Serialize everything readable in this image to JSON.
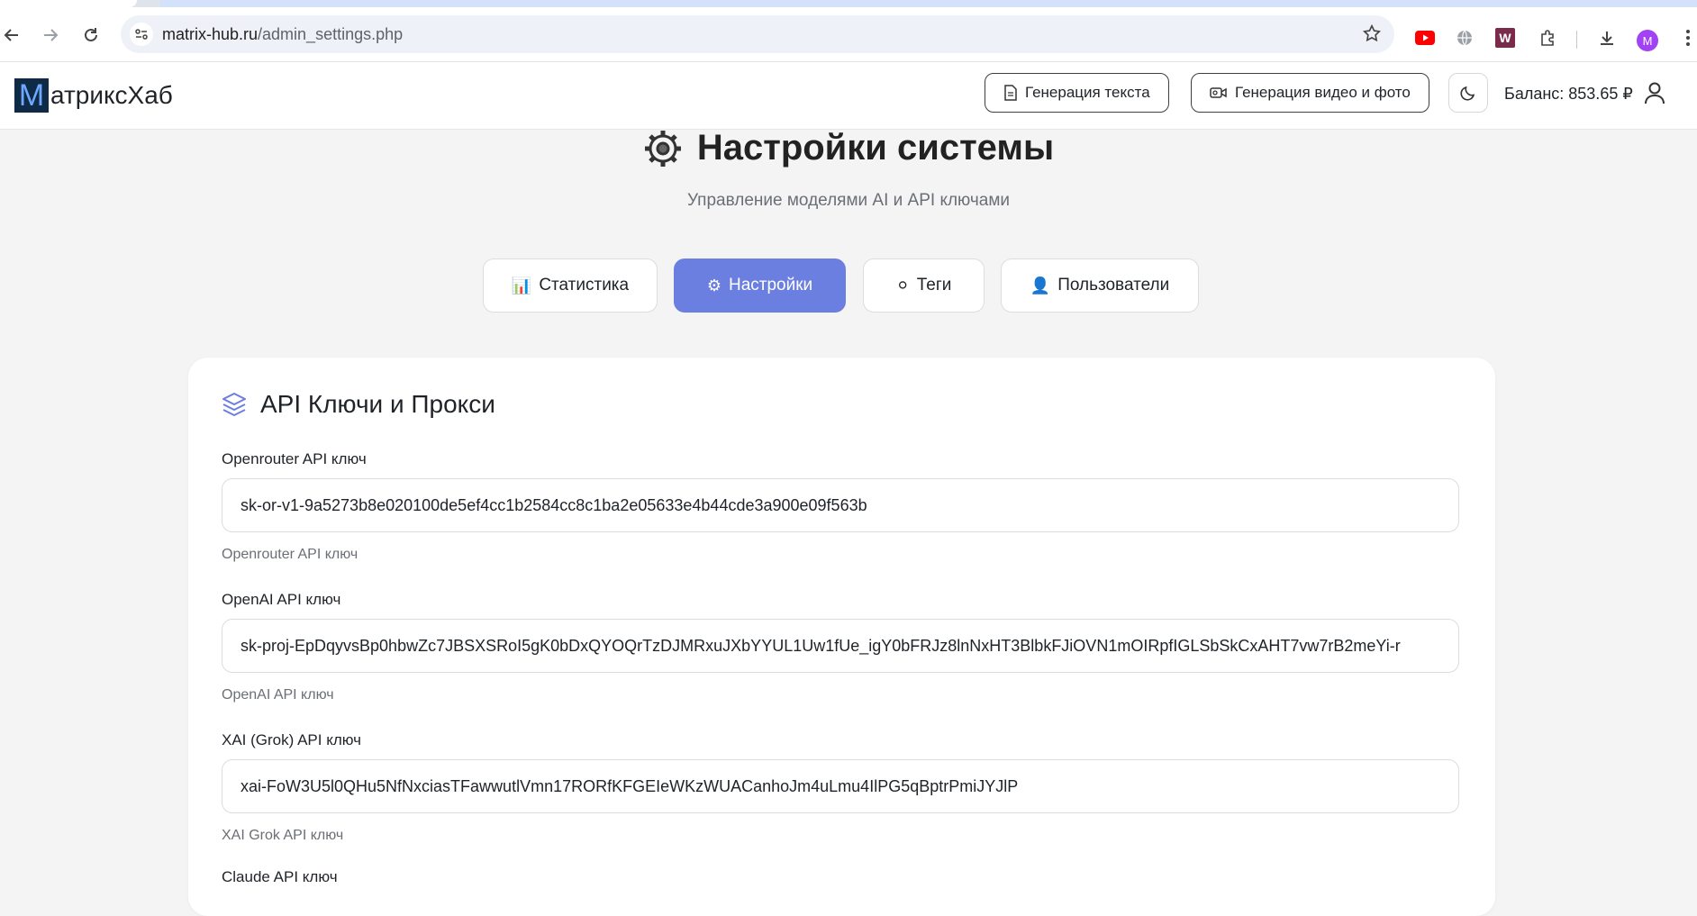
{
  "browser": {
    "url_host": "matrix-hub.ru",
    "url_path": "/admin_settings.php",
    "profile_initial": "M"
  },
  "header": {
    "logo_letter": "M",
    "logo_text": "атриксХаб",
    "btn_text_gen": "Генерация текста",
    "btn_video_gen": "Генерация видео и фото",
    "balance": "Баланс: 853.65 ₽"
  },
  "page": {
    "title": "Настройки системы",
    "subtitle": "Управление моделями AI и API ключами"
  },
  "tabs": [
    {
      "icon": "📊",
      "label": "Статистика",
      "active": false
    },
    {
      "icon": "⚙",
      "label": "Настройки",
      "active": true
    },
    {
      "icon": "⚪",
      "label": "Теги",
      "active": false
    },
    {
      "icon": "👤",
      "label": "Пользователи",
      "active": false
    }
  ],
  "card": {
    "title": "API Ключи и Прокси",
    "fields": [
      {
        "label": "Openrouter API ключ",
        "value": "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",
        "help": "Openrouter API ключ"
      },
      {
        "label": "OpenAI API ключ",
        "value": "sk-proj-EpDqyvsBp0hbwZc7JBSXSRoI5gK0bDxQYOQrTzDJMRxuJXbYYUL1Uw1fUe_igY0bFRJz8lnNxHT3BlbkFJiOVN1mOIRpfIGLSbSkCxAHT7vw7rB2meYi-r",
        "help": "OpenAI API ключ"
      },
      {
        "label": "XAI (Grok) API ключ",
        "value": "xai-FoW3U5l0QHu5NfNxciasTFawwutlVmn17RORfKFGEIeWKzWUACanhoJm4uLmu4IlPG5qBptrPmiJYJlP",
        "help": "XAI Grok API ключ"
      },
      {
        "label": "Claude API ключ"
      }
    ]
  },
  "colors": {
    "accent": "#6b7fe0",
    "page_bg": "#f4f4f5"
  }
}
